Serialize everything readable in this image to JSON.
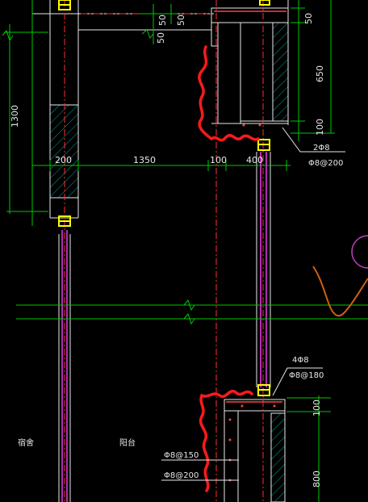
{
  "drawing": {
    "dimensions": {
      "d_1300": "1300",
      "d_200": "200",
      "d_1350": "1350",
      "d_100_mid": "100",
      "d_400": "400",
      "d_50_a": "50",
      "d_50_b": "50",
      "d_50_c": "50",
      "d_50_right": "50",
      "d_650": "650",
      "d_100_right": "100",
      "d_100_lower": "100",
      "d_800": "800"
    },
    "annotations": {
      "upper_top_bars": "2Φ8",
      "upper_stirrups": "Φ8@200",
      "lower_top_bars": "4Φ8",
      "lower_stirrups": "Φ8@180",
      "slab_bars_1": "Φ8@150",
      "slab_bars_2": "Φ8@200"
    },
    "rooms": {
      "left_room": "宿舍",
      "balcony": "阳台"
    },
    "colors": {
      "dimension_line": "#00c800",
      "section_line": "#e8e8e8",
      "center_line": "#ff3030",
      "markup": "#ff1a1a",
      "rebar": "#ff40ff",
      "column_marker": "#ffff00",
      "hatch": "#00a0a0",
      "callout_circle": "#c040c0",
      "sketch": "#d06010"
    }
  }
}
